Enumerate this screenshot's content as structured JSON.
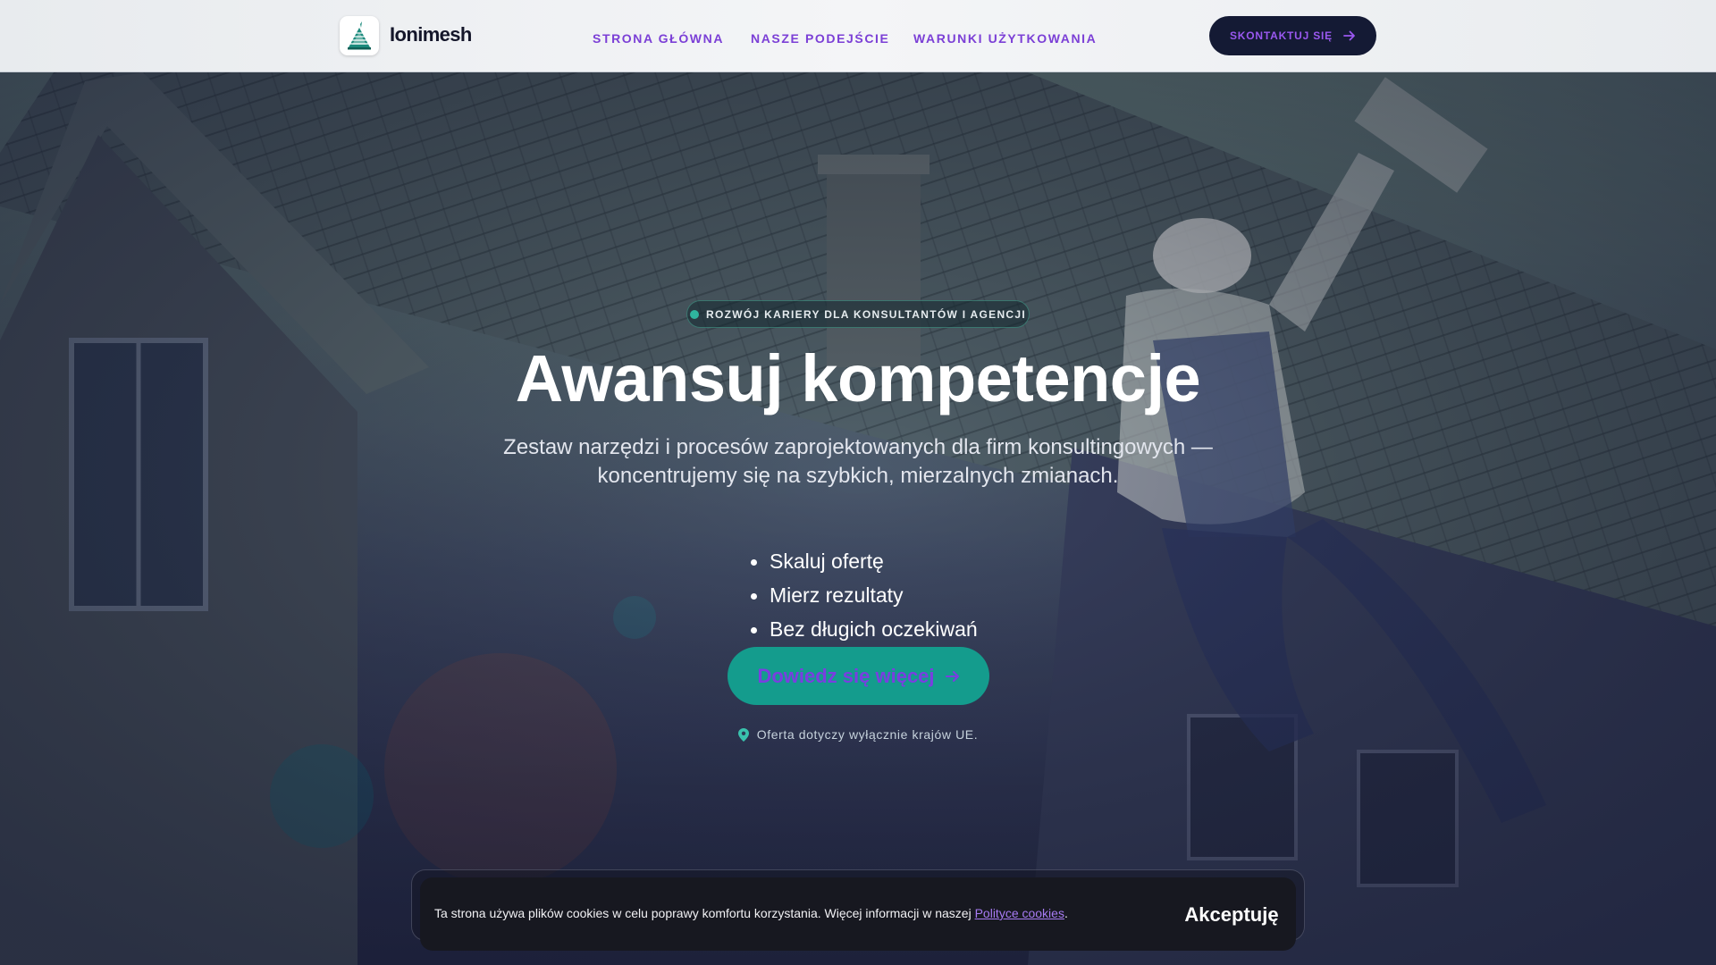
{
  "header": {
    "brand": "Ionimesh",
    "nav": [
      {
        "label": "STRONA GŁÓWNA"
      },
      {
        "label": "NASZE PODEJŚCIE"
      },
      {
        "label": "WARUNKI UŻYTKOWANIA"
      }
    ],
    "cta_label": "SKONTAKTUJ SIĘ",
    "cta_icon": "arrow-right-icon"
  },
  "hero": {
    "badge": "ROZWÓJ KARIERY DLA KONSULTANTÓW I AGENCJI",
    "title": "Awansuj kompetencje",
    "subtitle": "Zestaw narzędzi i procesów zaprojektowanych dla firm konsultingowych — koncentrujemy się na szybkich, mierzalnych zmianach.",
    "features": [
      "Skaluj ofertę",
      "Mierz rezultaty",
      "Bez długich oczekiwań"
    ],
    "cta_label": "Dowiedz się więcej",
    "note": "Oferta dotyczy wyłącznie krajów UE.",
    "note_icon": "location-pin-icon"
  },
  "cookie": {
    "text": "Ta strona używa plików cookies w celu poprawy komfortu korzystania. Więcej informacji w naszej ",
    "link_label": "Polityce cookies",
    "suffix": ".",
    "accept_label": "Akceptuję"
  },
  "colors": {
    "accent": "#7b3fd6",
    "teal": "#149c8d",
    "navy": "#141a34"
  }
}
